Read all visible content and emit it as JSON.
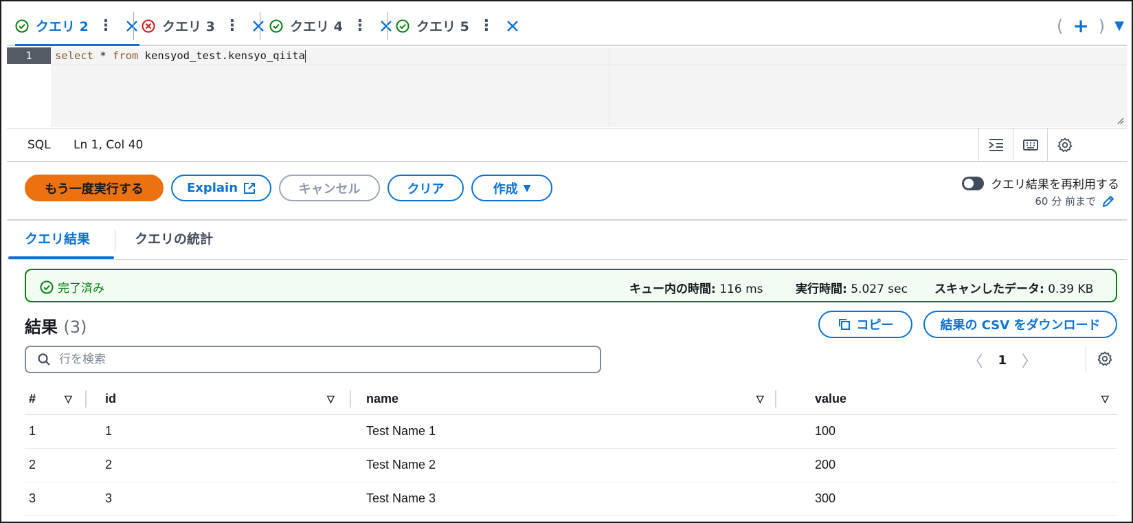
{
  "tabs": [
    {
      "label": "クエリ 2",
      "status": "success",
      "active": true
    },
    {
      "label": "クエリ 3",
      "status": "error",
      "active": false
    },
    {
      "label": "クエリ 4",
      "status": "success",
      "active": false
    },
    {
      "label": "クエリ 5",
      "status": "success",
      "active": false
    }
  ],
  "tab_add": {
    "open_paren": "(",
    "close_paren": ")",
    "plus": "+",
    "caret": "▼"
  },
  "editor": {
    "line_number": "1",
    "tokens": {
      "kw1": "select",
      "sp1": " * ",
      "kw2": "from",
      "sp2": " ",
      "table": "kensyod_test.kensyo_qiita"
    }
  },
  "statusbar": {
    "language": "SQL",
    "cursor_position": "Ln 1, Col 40"
  },
  "actions": {
    "run_again": "もう一度実行する",
    "explain": "Explain",
    "cancel": "キャンセル",
    "clear": "クリア",
    "create": "作成"
  },
  "reuse": {
    "label": "クエリ結果を再利用する",
    "sub": "60 分 前まで"
  },
  "result_tabs": {
    "results": "クエリ結果",
    "stats": "クエリの統計"
  },
  "status": {
    "state": "完了済み",
    "queue_label": "キュー内の時間:",
    "queue_value": "116 ms",
    "exec_label": "実行時間:",
    "exec_value": "5.027 sec",
    "scan_label": "スキャンしたデータ:",
    "scan_value": "0.39 KB"
  },
  "results": {
    "title": "結果",
    "count": "(3)",
    "copy_label": "コピー",
    "download_label": "結果の CSV をダウンロード",
    "search_placeholder": "行を検索",
    "page": "1"
  },
  "table": {
    "columns": [
      "#",
      "id",
      "name",
      "value"
    ],
    "rows": [
      [
        "1",
        "1",
        "Test Name 1",
        "100"
      ],
      [
        "2",
        "2",
        "Test Name 2",
        "200"
      ],
      [
        "3",
        "3",
        "Test Name 3",
        "300"
      ]
    ]
  },
  "colors": {
    "accent": "#0972d3",
    "primary_button": "#ec7211",
    "success": "#037f0c",
    "error": "#d91515"
  }
}
